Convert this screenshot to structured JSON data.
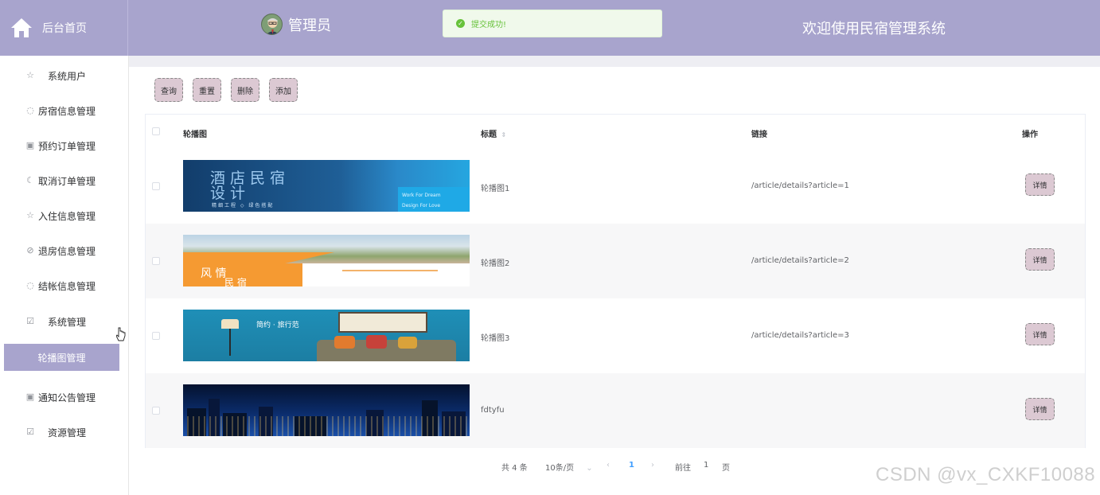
{
  "header": {
    "home_label": "后台首页",
    "admin_name": "管理员",
    "toast_text": "提交成功!",
    "site_title": "欢迎使用民宿管理系统"
  },
  "sidebar": {
    "items": [
      {
        "label": "系统用户",
        "icon": "star-icon"
      },
      {
        "label": "房宿信息管理",
        "icon": "flame-icon"
      },
      {
        "label": "预约订单管理",
        "icon": "bag-icon"
      },
      {
        "label": "取消订单管理",
        "icon": "moon-icon"
      },
      {
        "label": "入住信息管理",
        "icon": "star-icon"
      },
      {
        "label": "退房信息管理",
        "icon": "compass-icon"
      },
      {
        "label": "结帐信息管理",
        "icon": "flame-icon"
      },
      {
        "label": "系统管理",
        "icon": "checkbox-icon"
      },
      {
        "label": "轮播图管理",
        "icon": ""
      },
      {
        "label": "通知公告管理",
        "icon": "bag-icon"
      },
      {
        "label": "资源管理",
        "icon": "checkbox-icon"
      }
    ]
  },
  "toolbar": {
    "query": "查询",
    "reset": "重置",
    "delete": "删除",
    "add": "添加"
  },
  "table": {
    "columns": {
      "image": "轮播图",
      "title": "标题",
      "link": "链接",
      "action": "操作"
    },
    "rows": [
      {
        "title": "轮播图1",
        "link": "/article/details?article=1",
        "action": "详情",
        "banner_main": "酒店民宿",
        "banner_sub": "设计",
        "banner_tag": "精细工程  ◇  绿色搭配",
        "banner_side1": "Work For Dream",
        "banner_side2": "Design For Love"
      },
      {
        "title": "轮播图2",
        "link": "/article/details?article=2",
        "action": "详情",
        "banner_main": "风  情",
        "banner_sub": "民  宿"
      },
      {
        "title": "轮播图3",
        "link": "/article/details?article=3",
        "action": "详情",
        "banner_main": "简约 · 旅行范"
      },
      {
        "title": "fdtyfu",
        "link": "",
        "action": "详情"
      }
    ]
  },
  "pager": {
    "total": "共 4 条",
    "page_size": "10条/页",
    "prev": "‹",
    "current": "1",
    "next": "›",
    "goto_label": "前往",
    "goto_value": "1",
    "page_unit": "页"
  },
  "watermark": "CSDN @vx_CXKF10088",
  "colors": {
    "header_bg": "#a8a4cd",
    "button_bg": "#dcc9d3",
    "success": "#67c23a",
    "active_page": "#409eff"
  }
}
